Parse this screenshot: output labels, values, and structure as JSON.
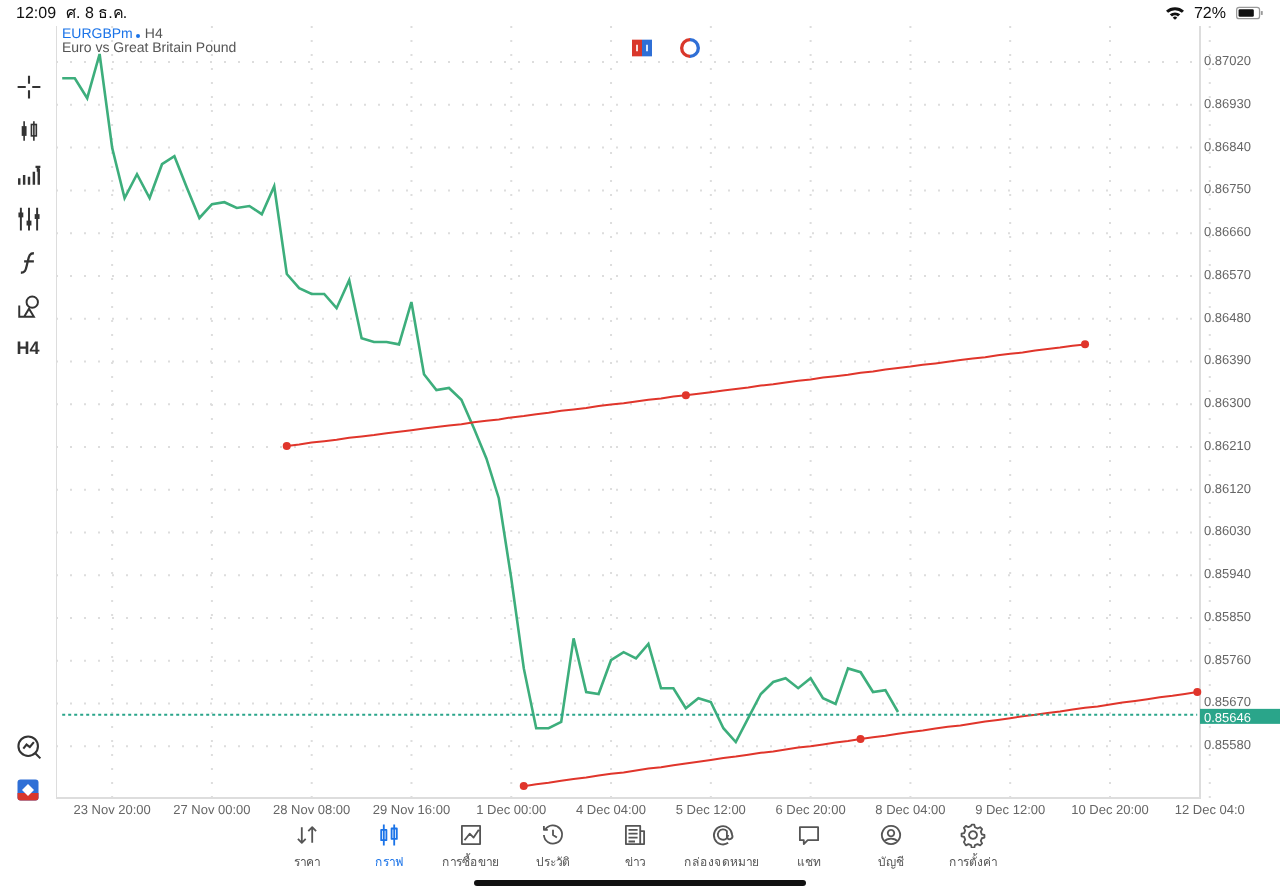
{
  "status_bar": {
    "time": "12:09",
    "date": "ศ. 8 ธ.ค.",
    "battery": "72%"
  },
  "chart": {
    "timeframe": "H4",
    "description": "Euro vs Great Britain Pound",
    "chart_data": {
      "type": "line",
      "categories": [
        null,
        null,
        null,
        null,
        "23 Nov 20:00",
        null,
        null,
        null,
        null,
        null,
        null,
        null,
        "27 Nov 00:00",
        null,
        null,
        null,
        null,
        null,
        null,
        null,
        "28 Nov 08:00",
        null,
        null,
        null,
        null,
        null,
        null,
        null,
        "29 Nov 16:00",
        null,
        null,
        null,
        null,
        null,
        null,
        null,
        "1 Dec 00:00",
        null,
        null,
        null,
        null,
        null,
        null,
        null,
        "4 Dec 04:00",
        null,
        null,
        null,
        null,
        null,
        null,
        null,
        "5 Dec 12:00",
        null,
        null,
        null,
        null,
        null,
        null,
        null,
        "6 Dec 20:00",
        null,
        null,
        null,
        null,
        null,
        null,
        null,
        "8 Dec 04:00",
        null,
        null,
        null,
        null,
        null,
        null,
        null,
        "9 Dec 12:00",
        null,
        null,
        null,
        null,
        null,
        null,
        null,
        "10 Dec 20:00",
        null,
        null,
        null,
        null,
        null,
        null,
        null,
        "12 Dec 04:0"
      ],
      "series": [
        {
          "name": "EURGBPm",
          "color": "#3dae7c",
          "values": [
            0.86986,
            0.86986,
            0.86944,
            0.87037,
            0.86839,
            0.86734,
            0.86784,
            0.86734,
            0.86805,
            0.86822,
            0.86755,
            0.86692,
            0.86721,
            0.86725,
            0.86713,
            0.86717,
            0.867,
            0.86759,
            0.86574,
            0.86544,
            0.86532,
            0.86532,
            0.86502,
            0.86561,
            0.86439,
            0.86431,
            0.86431,
            0.86426,
            0.86515,
            0.86363,
            0.8633,
            0.86334,
            0.86309,
            0.8625,
            0.86186,
            0.86102,
            0.85934,
            0.85744,
            0.85618,
            0.85618,
            0.85631,
            0.85807,
            0.85694,
            0.8569,
            0.85761,
            0.85778,
            0.85765,
            0.85795,
            0.85702,
            0.85702,
            0.8566,
            0.85681,
            0.85673,
            0.85618,
            0.85589,
            0.85639,
            0.8569,
            0.85715,
            0.85723,
            0.85702,
            0.85723,
            0.85681,
            0.85669,
            0.85744,
            0.85736,
            0.85694,
            0.85698,
            0.85652,
            null,
            null,
            null,
            null,
            null,
            null,
            null,
            null,
            null,
            null,
            null,
            null,
            null,
            null,
            null,
            null,
            null,
            null,
            null,
            null,
            null,
            null,
            null,
            null,
            null
          ]
        },
        {
          "color": "#e0352b",
          "values": [
            null,
            null,
            null,
            null,
            null,
            null,
            null,
            null,
            null,
            null,
            null,
            null,
            null,
            null,
            null,
            null,
            null,
            null,
            0.86212,
            0.86215,
            0.86219,
            0.86222,
            0.86225,
            0.86229,
            0.86232,
            0.86235,
            0.86239,
            0.86242,
            0.86245,
            0.86249,
            0.86252,
            0.86255,
            0.86258,
            0.86262,
            0.86265,
            0.86268,
            0.86272,
            0.86275,
            0.86279,
            0.86282,
            0.86286,
            0.86289,
            0.86292,
            0.86296,
            0.86299,
            0.86302,
            0.86306,
            0.86309,
            0.86312,
            0.86316,
            0.86319,
            0.86322,
            0.86325,
            0.86329,
            0.86332,
            0.86335,
            0.86339,
            0.86342,
            0.86346,
            0.86349,
            0.86352,
            0.86356,
            0.86359,
            0.86362,
            0.86366,
            0.86369,
            0.86373,
            0.86376,
            0.86379,
            0.86383,
            0.86386,
            0.86389,
            0.86393,
            0.86396,
            0.86399,
            0.86403,
            0.86406,
            0.86409,
            0.86413,
            0.86416,
            0.86419,
            0.86423,
            0.86426,
            null,
            null,
            null,
            null,
            null,
            null,
            null,
            null,
            null,
            null
          ]
        },
        {
          "color": "#e0352b",
          "values": [
            null,
            null,
            null,
            null,
            null,
            null,
            null,
            null,
            null,
            null,
            null,
            null,
            null,
            null,
            null,
            null,
            null,
            null,
            null,
            null,
            null,
            null,
            null,
            null,
            null,
            null,
            null,
            null,
            null,
            null,
            null,
            null,
            null,
            null,
            null,
            null,
            null,
            0.85496,
            0.855,
            0.85503,
            0.85507,
            0.85511,
            0.85514,
            0.85518,
            0.85522,
            0.85525,
            0.85529,
            0.85533,
            0.85536,
            0.8554,
            0.85544,
            0.85547,
            0.85551,
            0.85555,
            0.85558,
            0.85562,
            0.85566,
            0.85569,
            0.85573,
            0.85577,
            0.8558,
            0.85584,
            0.85588,
            0.85591,
            0.85595,
            0.85599,
            0.85602,
            0.85606,
            0.8561,
            0.85613,
            0.85617,
            0.85621,
            0.85624,
            0.85628,
            0.85632,
            0.85635,
            0.85639,
            0.85643,
            0.85646,
            0.8565,
            0.85653,
            0.85657,
            0.85661,
            0.85664,
            0.85668,
            0.85672,
            0.85675,
            0.85679,
            0.85683,
            0.85686,
            0.8569,
            0.85694,
            null
          ]
        },
        {
          "color": "#2aa58a",
          "line_style": "dotted",
          "values": [
            0.85646,
            0.85646,
            0.85646,
            0.85646,
            0.85646,
            0.85646,
            0.85646,
            0.85646,
            0.85646,
            0.85646,
            0.85646,
            0.85646,
            0.85646,
            0.85646,
            0.85646,
            0.85646,
            0.85646,
            0.85646,
            0.85646,
            0.85646,
            0.85646,
            0.85646,
            0.85646,
            0.85646,
            0.85646,
            0.85646,
            0.85646,
            0.85646,
            0.85646,
            0.85646,
            0.85646,
            0.85646,
            0.85646,
            0.85646,
            0.85646,
            0.85646,
            0.85646,
            0.85646,
            0.85646,
            0.85646,
            0.85646,
            0.85646,
            0.85646,
            0.85646,
            0.85646,
            0.85646,
            0.85646,
            0.85646,
            0.85646,
            0.85646,
            0.85646,
            0.85646,
            0.85646,
            0.85646,
            0.85646,
            0.85646,
            0.85646,
            0.85646,
            0.85646,
            0.85646,
            0.85646,
            0.85646,
            0.85646,
            0.85646,
            0.85646,
            0.85646,
            0.85646,
            0.85646,
            0.85646,
            0.85646,
            0.85646,
            0.85646,
            0.85646,
            0.85646,
            0.85646,
            0.85646,
            0.85646,
            0.85646,
            0.85646,
            0.85646,
            0.85646,
            0.85646,
            0.85646,
            0.85646,
            0.85646,
            0.85646,
            0.85646,
            0.85646,
            0.85646,
            0.85646,
            0.85646,
            0.85646,
            null
          ]
        }
      ],
      "ylim": [
        0.85471,
        0.87096
      ],
      "yticks": [
        {
          "value": 0.8558,
          "label": "0.85580"
        },
        {
          "value": 0.8567,
          "label": "0.85670"
        },
        {
          "value": 0.8576,
          "label": "0.85760"
        },
        {
          "value": 0.8585,
          "label": "0.85850"
        },
        {
          "value": 0.8594,
          "label": "0.85940"
        },
        {
          "value": 0.8603,
          "label": "0.86030"
        },
        {
          "value": 0.8612,
          "label": "0.86120"
        },
        {
          "value": 0.8621,
          "label": "0.86210"
        },
        {
          "value": 0.863,
          "label": "0.86300"
        },
        {
          "value": 0.8639,
          "label": "0.86390"
        },
        {
          "value": 0.8648,
          "label": "0.86480"
        },
        {
          "value": 0.8657,
          "label": "0.86570"
        },
        {
          "value": 0.8666,
          "label": "0.86660"
        },
        {
          "value": 0.8675,
          "label": "0.86750"
        },
        {
          "value": 0.8684,
          "label": "0.86840"
        },
        {
          "value": 0.8693,
          "label": "0.86930"
        },
        {
          "value": 0.8702,
          "label": "0.87020"
        }
      ],
      "grid": true
    },
    "current_price": "0.85646"
  },
  "toolbar": {
    "timeframe": "H4"
  },
  "tabs": [
    {
      "label": "ราคา",
      "selected": false
    },
    {
      "label": "กราฟ",
      "selected": true
    },
    {
      "label": "การซื้อขาย",
      "selected": false
    },
    {
      "label": "ประวัติ",
      "selected": false
    },
    {
      "label": "ข่าว",
      "selected": false
    },
    {
      "label": "กล่องจดหมาย",
      "selected": false
    },
    {
      "label": "แชท",
      "selected": false
    },
    {
      "label": "บัญชี",
      "selected": false
    },
    {
      "label": "การตั้งค่า",
      "selected": false
    }
  ]
}
